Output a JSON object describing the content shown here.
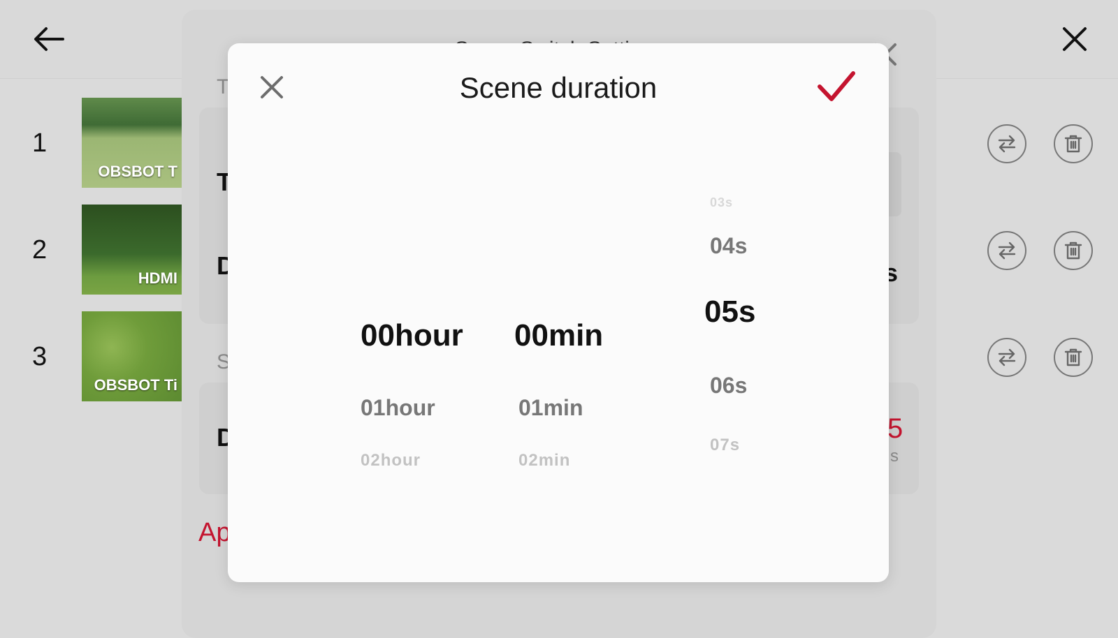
{
  "topbar": {
    "back_icon": "arrow-left-icon",
    "close_icon": "close-icon"
  },
  "background": {
    "panel_title": "Scene Switch Settings",
    "left_letters": {
      "t1": "T",
      "t2": "T",
      "d1": "D",
      "s": "S",
      "d2": "D",
      "ap": "Ap"
    },
    "right_fragments": {
      "s_suffix": "s",
      "value": "5",
      "unit": "s"
    }
  },
  "scenes": [
    {
      "number": "1",
      "label": "OBSBOT T"
    },
    {
      "number": "2",
      "label": "HDMI"
    },
    {
      "number": "3",
      "label": "OBSBOT Ti"
    }
  ],
  "modal": {
    "title": "Scene duration",
    "hours": {
      "selected": "00hour",
      "next1": "01hour",
      "next2": "02hour"
    },
    "minutes": {
      "selected": "00min",
      "next1": "01min",
      "next2": "02min"
    },
    "seconds": {
      "prev2": "03s",
      "prev1": "04s",
      "selected": "05s",
      "next1": "06s",
      "next2": "07s"
    }
  },
  "colors": {
    "accent": "#c4142f",
    "background": "#dadada",
    "modal": "#fbfbfb"
  }
}
